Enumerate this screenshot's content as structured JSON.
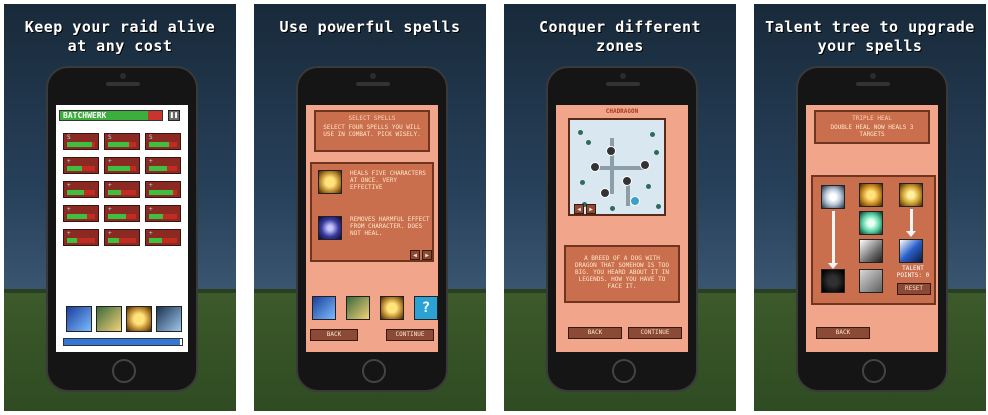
{
  "panels": [
    {
      "caption_line1": "Keep your raid alive",
      "caption_line2": "at any cost",
      "boss_name": "BATCHWERK",
      "boss_health": 0.86,
      "pause_icon": "pause-icon",
      "raid_frames": [
        {
          "hp": 0.9,
          "mark": "S"
        },
        {
          "hp": 0.75,
          "mark": "S"
        },
        {
          "hp": 0.7,
          "mark": "S"
        },
        {
          "hp": 0.55,
          "mark": "+"
        },
        {
          "hp": 0.8,
          "mark": "+"
        },
        {
          "hp": 0.65,
          "mark": "+"
        },
        {
          "hp": 0.6,
          "mark": "+"
        },
        {
          "hp": 0.45,
          "mark": "+"
        },
        {
          "hp": 0.85,
          "mark": "+"
        },
        {
          "hp": 0.7,
          "mark": "+"
        },
        {
          "hp": 0.65,
          "mark": "+"
        },
        {
          "hp": 0.5,
          "mark": "+"
        },
        {
          "hp": 0.35,
          "mark": "+"
        },
        {
          "hp": 0.4,
          "mark": "+"
        },
        {
          "hp": 0.45,
          "mark": "+"
        }
      ],
      "spell_icons": [
        "lightning-heal-icon",
        "hand-heal-icon",
        "golden-shield-icon",
        "angel-icon"
      ],
      "mana": 0.98
    },
    {
      "caption_line1": "Use powerful spells",
      "header": "SELECT SPELLS",
      "subheader": "SELECT FOUR SPELLS YOU WILL USE IN COMBAT. PICK WISELY.",
      "spells": [
        {
          "icon": "golden-ring-icon",
          "desc": "HEALS FIVE CHARACTERS AT ONCE. VERY EFFECTIVE"
        },
        {
          "icon": "purple-orb-icon",
          "desc": "REMOVES HARMFUL EFFECT FROM CHARACTER. DOES NOT HEAL."
        }
      ],
      "bottom_spells": [
        "lightning-heal-icon",
        "hand-heal-icon",
        "golden-shield-icon",
        "question-icon"
      ],
      "back_label": "BACK",
      "continue_label": "CONTINUE"
    },
    {
      "caption_line1": "Conquer different",
      "caption_line2": "zones",
      "zone_title": "CHADRAGON",
      "story": "A BREED OF A DOG WITH DRAGON THAT SOMEHOW IS TOO BIG. YOU HEARD ABOUT IT IN LEGENDS. HOW YOU HAVE TO FACE IT.",
      "back_label": "BACK",
      "continue_label": "CONTINUE"
    },
    {
      "caption_line1": "Talent tree to upgrade",
      "caption_line2": "your spells",
      "talent_title": "TRIPLE HEAL",
      "talent_desc": "DOUBLE HEAL NOW HEALS 3 TARGETS",
      "talent_points": "TALENT POINTS: 0",
      "reset_label": "RESET",
      "back_label": "BACK"
    }
  ],
  "colors": {
    "parchment": "#f1a58b",
    "scroll": "#c96f4e",
    "health_green": "#3fbf3f",
    "health_red": "#c22b22",
    "mana_blue": "#3477d6"
  }
}
